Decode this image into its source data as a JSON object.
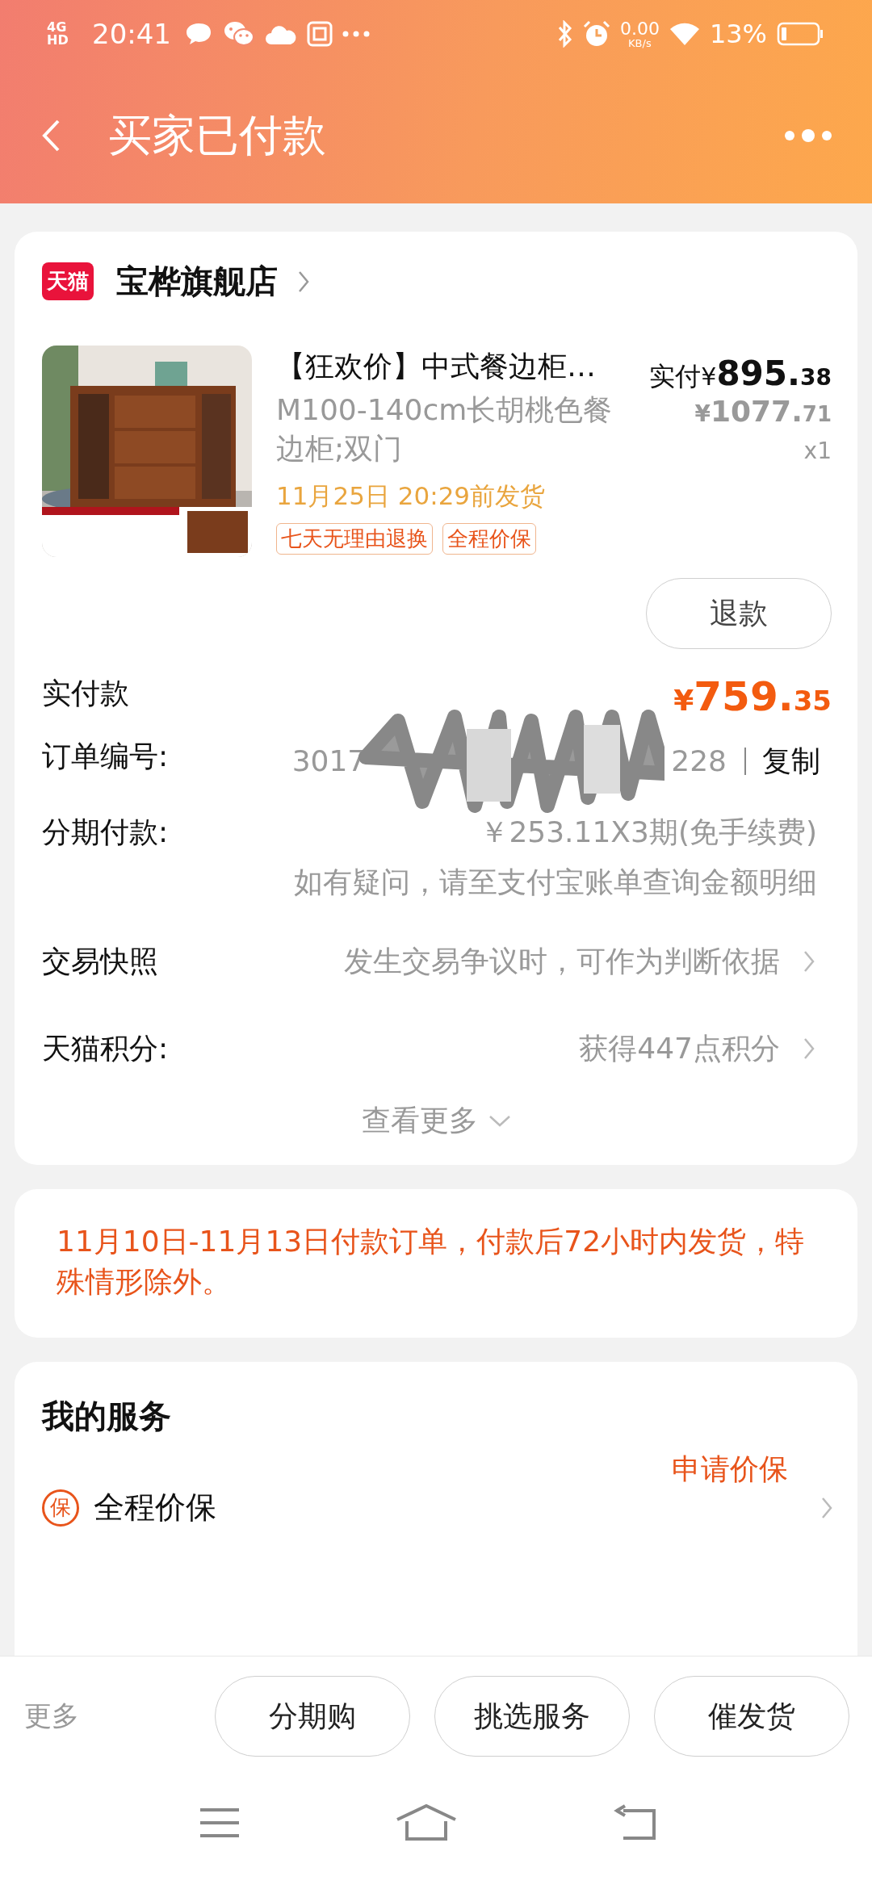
{
  "status_bar": {
    "network": "4G HD",
    "time": "20:41",
    "speed": "0.00",
    "speed_unit": "KB/s",
    "battery": "13%"
  },
  "header": {
    "title": "买家已付款"
  },
  "shop": {
    "badge": "天猫",
    "name": "宝桦旗舰店"
  },
  "product": {
    "image": {
      "kind": "picture"
    },
    "title": "【狂欢价】中式餐边柜…",
    "variant": "M100-140cm长胡桃色餐边柜;双门",
    "ship_by": "11月25日 20:29前发货",
    "tags": [
      "七天无理由退换",
      "全程价保"
    ],
    "paid_label": "实付",
    "paid": {
      "currency": "¥",
      "integer": "895.",
      "fraction": "38"
    },
    "original": {
      "currency": "¥",
      "integer": "1077.",
      "fraction": "71"
    },
    "quantity": "x1",
    "refund_button": "退款"
  },
  "rows": [
    {
      "kind": "amount",
      "label": "实付款",
      "price": {
        "currency": "¥",
        "integer": "759.",
        "fraction": "35"
      }
    },
    {
      "kind": "order_number",
      "label": "订单编号:",
      "number_start": "3017",
      "number_end": "228",
      "action": "复制"
    },
    {
      "kind": "installment",
      "label": "分期付款:",
      "value": "￥253.11X3期(免手续费)",
      "note": "如有疑问，请至支付宝账单查询金额明细"
    },
    {
      "kind": "link",
      "label": "交易快照",
      "value": "发生交易争议时，可作为判断依据"
    },
    {
      "kind": "link",
      "label": "天猫积分:",
      "value": "获得447点积分"
    }
  ],
  "more_link": "查看更多",
  "notice": "11月10日-11月13日付款订单，付款后72小时内发货，特殊情形除外。",
  "services": {
    "title": "我的服务",
    "action": "申请价保",
    "items": [
      {
        "badge": "保",
        "name": "全程价保"
      }
    ]
  },
  "bottom_bar": {
    "more": "更多",
    "buttons": [
      "分期购",
      "挑选服务",
      "催发货"
    ]
  }
}
